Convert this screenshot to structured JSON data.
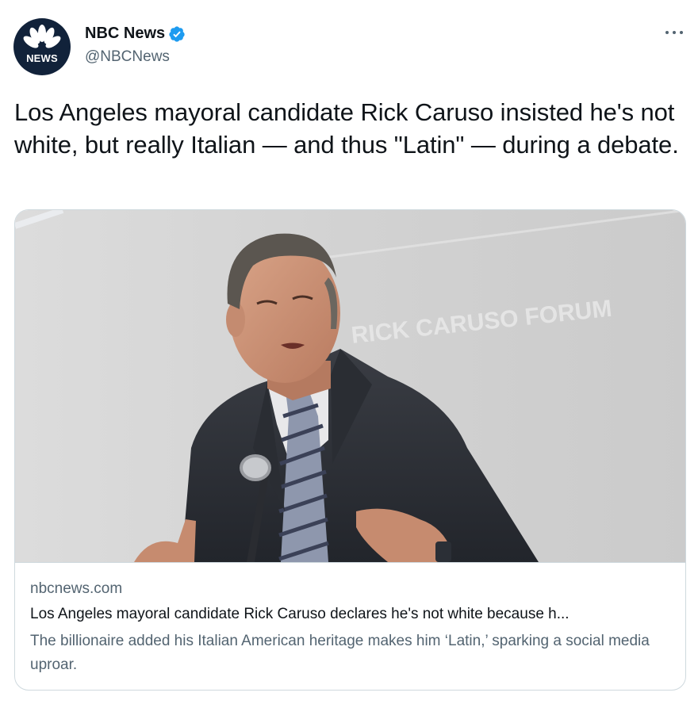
{
  "author": {
    "display_name": "NBC News",
    "handle": "@NBCNews",
    "verified": true,
    "avatar_label": "NEWS",
    "avatar_icon": "peacock-logo-icon"
  },
  "tweet": {
    "text": "Los Angeles mayoral candidate Rick Caruso insisted he's not white, but really Italian — and thus \"Latin\" — during a debate."
  },
  "card": {
    "image_caption": "RICK CARUSO FORUM",
    "domain": "nbcnews.com",
    "title": "Los Angeles mayoral candidate Rick Caruso declares he's not white because h...",
    "description": "The billionaire added his Italian American heritage makes him ‘Latin,’ sparking a social media uproar."
  },
  "colors": {
    "verified_blue": "#1d9bf0",
    "secondary_text": "#536471",
    "avatar_bg": "#11223a"
  }
}
